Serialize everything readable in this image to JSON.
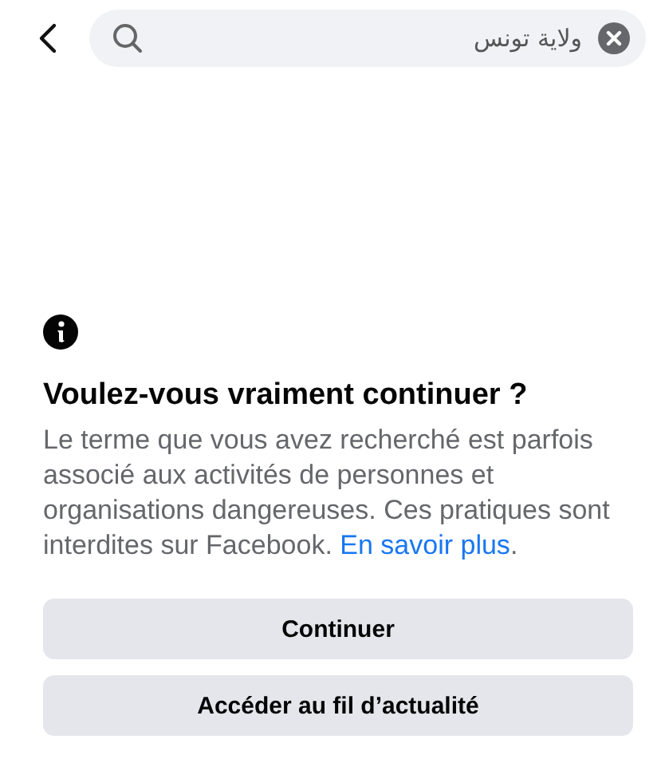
{
  "search": {
    "value": "ولاية تونس"
  },
  "dialog": {
    "title": "Voulez-vous vraiment continuer ?",
    "body": "Le terme que vous avez recherché est parfois associé aux activités de personnes et organisations dangereuses. Ces pratiques sont interdites sur Facebook.",
    "link": "En savoir plus",
    "link_end": "."
  },
  "buttons": [
    "Continuer",
    "Accéder au fil d’actualité"
  ]
}
